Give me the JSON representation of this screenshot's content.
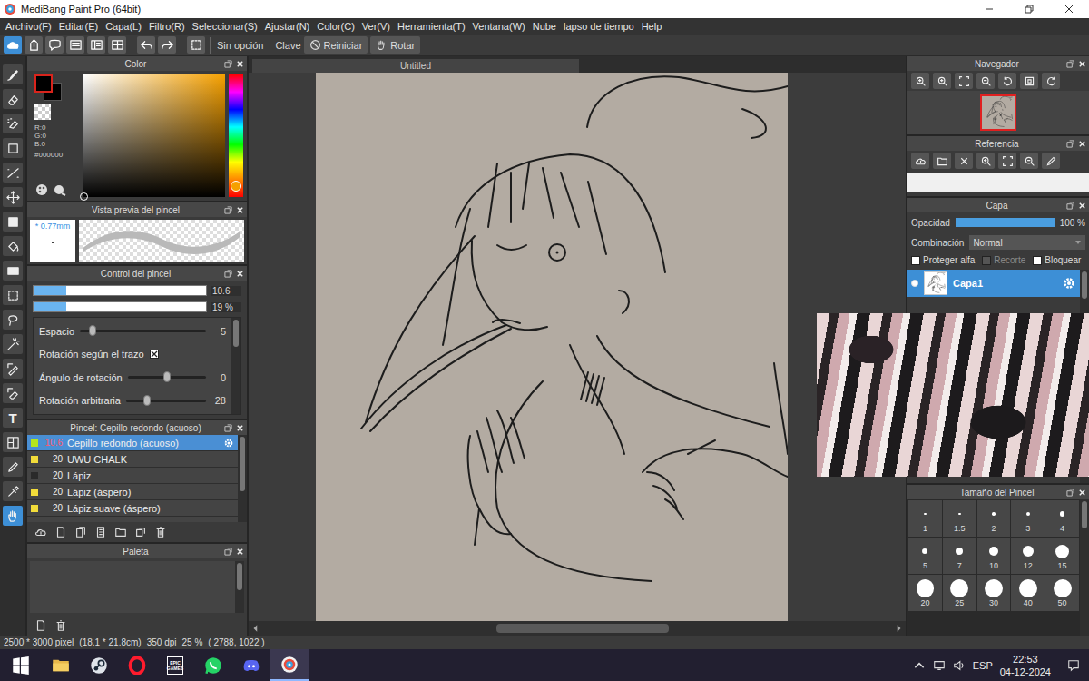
{
  "window": {
    "title": "MediBang Paint Pro (64bit)"
  },
  "menu": [
    "Archivo(F)",
    "Editar(E)",
    "Capa(L)",
    "Filtro(R)",
    "Seleccionar(S)",
    "Ajustar(N)",
    "Color(C)",
    "Ver(V)",
    "Herramienta(T)",
    "Ventana(W)",
    "Nube",
    "lapso de tiempo",
    "Help"
  ],
  "toolbar": {
    "icons": [
      {
        "kind": "blend",
        "selected": true
      },
      {
        "kind": "export",
        "selected": false
      },
      {
        "kind": "bubble",
        "selected": false
      },
      {
        "kind": "panel",
        "selected": false
      },
      {
        "kind": "layers",
        "selected": false
      },
      {
        "kind": "grid",
        "selected": false
      },
      {
        "kind": "undo",
        "selected": false
      },
      {
        "kind": "redo",
        "selected": false
      },
      {
        "kind": "select-dots",
        "selected": false
      }
    ],
    "option": "Sin opción",
    "key_label": "Clave",
    "reset": "Reiniciar",
    "rotate": "Rotar"
  },
  "tools": [
    {
      "kind": "brush",
      "selected": false
    },
    {
      "kind": "eraser",
      "selected": false
    },
    {
      "kind": "dot-eraser",
      "selected": false
    },
    {
      "kind": "rect",
      "selected": false
    },
    {
      "kind": "line",
      "selected": false
    },
    {
      "kind": "move",
      "selected": false
    },
    {
      "kind": "fill-rect",
      "selected": false
    },
    {
      "kind": "bucket",
      "selected": false
    },
    {
      "kind": "gradient",
      "selected": false
    },
    {
      "kind": "select",
      "selected": false
    },
    {
      "kind": "lasso",
      "selected": false
    },
    {
      "kind": "wand",
      "selected": false
    },
    {
      "kind": "select-pen",
      "selected": false
    },
    {
      "kind": "select-eraser",
      "selected": false
    },
    {
      "kind": "text",
      "label": "T",
      "selected": false
    },
    {
      "kind": "divide",
      "selected": false
    },
    {
      "kind": "pen",
      "selected": false
    },
    {
      "kind": "dropper",
      "selected": false
    },
    {
      "kind": "hand",
      "selected": true
    }
  ],
  "color": {
    "title": "Color",
    "primary": "#000000",
    "secondary": "#000000",
    "r": "R:0",
    "g": "G:0",
    "b": "B:0",
    "hex": "#000000",
    "hue_level": 0.91
  },
  "brush_preview": {
    "title": "Vista previa del pincel",
    "size": "* 0.77mm"
  },
  "brush_control": {
    "title": "Control del pincel",
    "size": {
      "value": "10.6",
      "level": 0.19
    },
    "opacity": {
      "value": "19 %",
      "level": 0.19
    },
    "rows": [
      {
        "kind": "slider",
        "label": "Espacio",
        "value": "5",
        "level": 0.1
      },
      {
        "kind": "checkbox",
        "label": "Rotación según el trazo",
        "checked": true
      },
      {
        "kind": "slider",
        "label": "Ángulo de rotación",
        "value": "0",
        "level": 0.5
      },
      {
        "kind": "slider",
        "label": "Rotación arbitraria",
        "value": "28",
        "level": 0.26
      }
    ]
  },
  "brushes": {
    "title": "Pincel: Cepillo redondo (acuoso)",
    "items": [
      {
        "size": "10.6",
        "name": "Cepillo redondo (acuoso)",
        "selected": true,
        "color": "#b5e61d"
      },
      {
        "size": "20",
        "name": "UWU CHALK",
        "selected": false,
        "color": "#f2dc3a"
      },
      {
        "size": "20",
        "name": "Lápiz",
        "selected": false,
        "color": "#2a2a2a"
      },
      {
        "size": "20",
        "name": "Lápiz (áspero)",
        "selected": false,
        "color": "#f2dc3a"
      },
      {
        "size": "20",
        "name": "Lápiz suave (áspero)",
        "selected": false,
        "color": "#f2dc3a"
      }
    ]
  },
  "palette": {
    "title": "Paleta",
    "footer": "---"
  },
  "canvas": {
    "tab": "Untitled"
  },
  "navigator": {
    "title": "Navegador"
  },
  "reference": {
    "title": "Referencia"
  },
  "layers": {
    "title": "Capa",
    "opacity_label": "Opacidad",
    "opacity": {
      "value": "100 %",
      "level": 1
    },
    "blend_label": "Combinación",
    "blend": "Normal",
    "options": [
      {
        "label": "Proteger alfa",
        "checked": false,
        "disabled": false
      },
      {
        "label": "Recorte",
        "checked": false,
        "disabled": true
      },
      {
        "label": "Bloquear",
        "checked": false,
        "disabled": false
      }
    ],
    "items": [
      {
        "name": "Capa1",
        "visible": true,
        "selected": true
      }
    ]
  },
  "brush_sizes": {
    "title": "Tamaño del Pincel",
    "sizes": [
      "1",
      "1.5",
      "2",
      "3",
      "4",
      "5",
      "7",
      "10",
      "12",
      "15",
      "20",
      "25",
      "30",
      "40",
      "50"
    ]
  },
  "status_bar": {
    "size": "2500 * 3000 pixel",
    "physical": "(18.1 * 21.8cm)",
    "dpi": "350 dpi",
    "zoom": "25 %",
    "cursor": "( 2788, 1022 )"
  },
  "taskbar": {
    "apps": [
      {
        "kind": "windows",
        "active": false
      },
      {
        "kind": "folder",
        "active": false
      },
      {
        "kind": "steam",
        "active": false
      },
      {
        "kind": "opera",
        "active": false
      },
      {
        "kind": "epic",
        "active": false,
        "label": "EPIC GAMES"
      },
      {
        "kind": "whatsapp",
        "active": false
      },
      {
        "kind": "discord",
        "active": false
      },
      {
        "kind": "medibang",
        "active": true
      }
    ],
    "language": "ESP",
    "time": "22:53",
    "date": "04-12-2024"
  }
}
